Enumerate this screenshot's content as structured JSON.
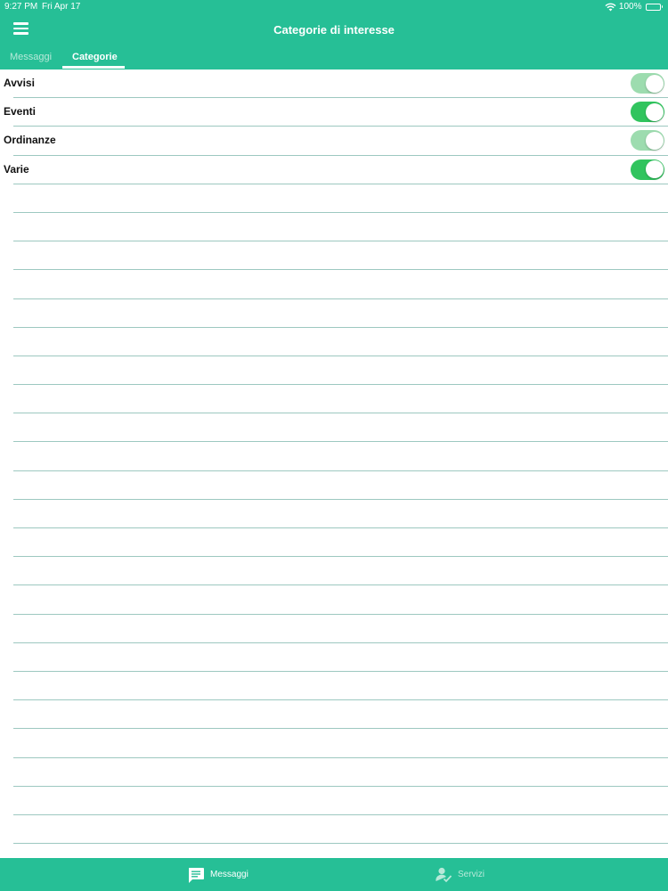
{
  "status_bar": {
    "time": "9:27 PM",
    "date": "Fri Apr 17",
    "battery": "100%"
  },
  "header": {
    "title": "Categorie di interesse"
  },
  "tabs": [
    {
      "label": "Messaggi",
      "active": false
    },
    {
      "label": "Categorie",
      "active": true
    }
  ],
  "categories": [
    {
      "label": "Avvisi",
      "enabled": true,
      "dimmed": true
    },
    {
      "label": "Eventi",
      "enabled": true,
      "dimmed": false
    },
    {
      "label": "Ordinanze",
      "enabled": true,
      "dimmed": true
    },
    {
      "label": "Varie",
      "enabled": true,
      "dimmed": false
    }
  ],
  "tabbar": {
    "items": [
      {
        "label": "Messaggi",
        "icon": "message-icon",
        "active": true
      },
      {
        "label": "Servizi",
        "icon": "user-check-icon",
        "active": false
      }
    ]
  },
  "colors": {
    "accent": "#26bf96",
    "toggle_on": "#31c45e",
    "toggle_dim": "#9ddcaf"
  }
}
